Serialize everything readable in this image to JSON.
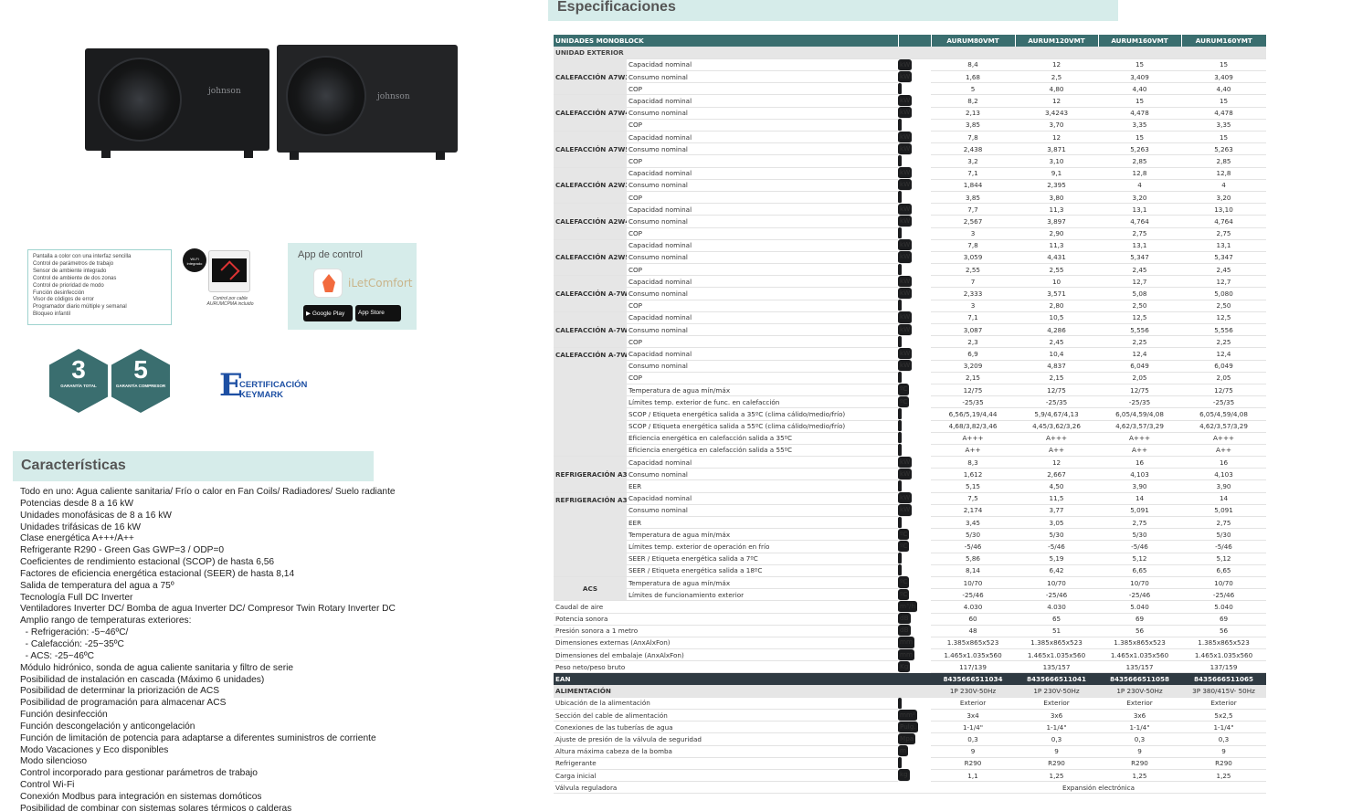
{
  "product": {
    "brand": "johnson"
  },
  "features_box": [
    "Pantalla a color con una interfaz sencilla",
    "Control de parámetros de trabajo",
    "Sensor de ambiente integrado",
    "Control de ambiente de dos zonas",
    "Control de prioridad de modo",
    "Función desinfección",
    "Visor de códigos de error",
    "Programador diario múltiple y semanal",
    "Bloqueo infantil"
  ],
  "wifi": {
    "label": "Wi-Fi integrado",
    "caption": "Control por cable AURUMCPMA incluido"
  },
  "app": {
    "title": "App de control",
    "name": "iLetComfort",
    "google": "Google Play",
    "apple": "App Store"
  },
  "badges": [
    {
      "num": "3",
      "label": "GARANTÍA TOTAL"
    },
    {
      "num": "5",
      "label": "GARANTÍA COMPRESOR"
    }
  ],
  "keymark": {
    "line1": "CERTIFICACIÓN",
    "line2": "KEYMARK"
  },
  "caracteristicas": {
    "title": "Características",
    "items": [
      "Todo en uno: Agua caliente sanitaria/ Frío o calor en Fan Coils/ Radiadores/ Suelo radiante",
      "Potencias desde 8 a 16 kW",
      "Unidades monofásicas de 8 a 16 kW",
      "Unidades trifásicas de 16 kW",
      "Clase energética A+++/A++",
      "Refrigerante R290 - Green Gas GWP=3 / ODP=0",
      "Coeficientes de rendimiento estacional (SCOP) de hasta 6,56",
      "Factores de eficiencia energética estacional (SEER) de hasta 8,14",
      "Salida de temperatura del agua a 75º",
      "Tecnología Full DC Inverter",
      "Ventiladores Inverter DC/ Bomba de agua Inverter DC/ Compresor Twin Rotary Inverter DC",
      "Amplio rango de temperaturas exteriores:",
      "  - Refrigeración: -5~46ºC/",
      "  - Calefacción: -25~35ºC",
      "  - ACS: -25~46ºC",
      "Módulo hidrónico, sonda de agua caliente sanitaria y filtro de serie",
      "Posibilidad de instalación en cascada (Máximo 6 unidades)",
      "Posibilidad de determinar la priorización de ACS",
      "Posibilidad de programación para almacenar ACS",
      "Función desinfección",
      "Función descongelación y anticongelación",
      "Función de limitación de potencia para adaptarse a diferentes suministros de corriente",
      "Modo Vacaciones y Eco disponibles",
      "Modo silencioso",
      "Control incorporado para gestionar parámetros de trabajo",
      "Control Wi-Fi",
      "Conexión Modbus para integración en sistemas domóticos",
      "Posibilidad de combinar con sistemas solares térmicos o calderas"
    ]
  },
  "spec": {
    "title": "Especificaciones",
    "header": [
      "UNIDADES MONOBLOCK",
      "AURUM80VMT",
      "AURUM120VMT",
      "AURUM160VMT",
      "AURUM160YMT"
    ],
    "subheader": "UNIDAD EXTERIOR",
    "groups": [
      {
        "name": "CALEFACCIÓN A7W35",
        "rows": [
          [
            "Capacidad nominal",
            "kW",
            "8,4",
            "12",
            "15",
            "15"
          ],
          [
            "Consumo nominal",
            "kW",
            "1,68",
            "2,5",
            "3,409",
            "3,409"
          ],
          [
            "COP",
            "",
            "5",
            "4,80",
            "4,40",
            "4,40"
          ]
        ]
      },
      {
        "name": "CALEFACCIÓN A7W45",
        "rows": [
          [
            "Capacidad nominal",
            "kW",
            "8,2",
            "12",
            "15",
            "15"
          ],
          [
            "Consumo nominal",
            "kW",
            "2,13",
            "3,4243",
            "4,478",
            "4,478"
          ],
          [
            "COP",
            "",
            "3,85",
            "3,70",
            "3,35",
            "3,35"
          ]
        ]
      },
      {
        "name": "CALEFACCIÓN A7W55",
        "rows": [
          [
            "Capacidad nominal",
            "kW",
            "7,8",
            "12",
            "15",
            "15"
          ],
          [
            "Consumo nominal",
            "kW",
            "2,438",
            "3,871",
            "5,263",
            "5,263"
          ],
          [
            "COP",
            "",
            "3,2",
            "3,10",
            "2,85",
            "2,85"
          ]
        ]
      },
      {
        "name": "CALEFACCIÓN A2W35",
        "rows": [
          [
            "Capacidad nominal",
            "kW",
            "7,1",
            "9,1",
            "12,8",
            "12,8"
          ],
          [
            "Consumo nominal",
            "kW",
            "1,844",
            "2,395",
            "4",
            "4"
          ],
          [
            "COP",
            "",
            "3,85",
            "3,80",
            "3,20",
            "3,20"
          ]
        ]
      },
      {
        "name": "CALEFACCIÓN A2W45",
        "rows": [
          [
            "Capacidad nominal",
            "kW",
            "7,7",
            "11,3",
            "13,1",
            "13,10"
          ],
          [
            "Consumo nominal",
            "kW",
            "2,567",
            "3,897",
            "4,764",
            "4,764"
          ],
          [
            "COP",
            "",
            "3",
            "2,90",
            "2,75",
            "2,75"
          ]
        ]
      },
      {
        "name": "CALEFACCIÓN A2W55",
        "rows": [
          [
            "Capacidad nominal",
            "kW",
            "7,8",
            "11,3",
            "13,1",
            "13,1"
          ],
          [
            "Consumo nominal",
            "kW",
            "3,059",
            "4,431",
            "5,347",
            "5,347"
          ],
          [
            "COP",
            "",
            "2,55",
            "2,55",
            "2,45",
            "2,45"
          ]
        ]
      },
      {
        "name": "CALEFACCIÓN A-7W35",
        "rows": [
          [
            "Capacidad nominal",
            "kW",
            "7",
            "10",
            "12,7",
            "12,7"
          ],
          [
            "Consumo nominal",
            "kW",
            "2,333",
            "3,571",
            "5,08",
            "5,080"
          ],
          [
            "COP",
            "",
            "3",
            "2,80",
            "2,50",
            "2,50"
          ]
        ]
      },
      {
        "name": "CALEFACCIÓN A-7W45",
        "rows": [
          [
            "Capacidad nominal",
            "kW",
            "7,1",
            "10,5",
            "12,5",
            "12,5"
          ],
          [
            "Consumo nominal",
            "kW",
            "3,087",
            "4,286",
            "5,556",
            "5,556"
          ],
          [
            "COP",
            "",
            "2,3",
            "2,45",
            "2,25",
            "2,25"
          ]
        ]
      },
      {
        "name": "CALEFACCIÓN A-7W55",
        "rows": [
          [
            "Capacidad nominal",
            "kW",
            "6,9",
            "10,4",
            "12,4",
            "12,4"
          ],
          [
            "Consumo nominal",
            "kW",
            "3,209",
            "4,837",
            "6,049",
            "6,049"
          ],
          [
            "COP",
            "",
            "2,15",
            "2,15",
            "2,05",
            "2,05"
          ],
          [
            "Temperatura de agua mín/máx",
            "ºC",
            "12/75",
            "12/75",
            "12/75",
            "12/75"
          ],
          [
            "Límites temp. exterior de func. en calefacción",
            "ºC",
            "-25/35",
            "-25/35",
            "-25/35",
            "-25/35"
          ],
          [
            "SCOP / Etiqueta energética salida a 35ºC (clima cálido/medio/frío)",
            "",
            "6,56/5,19/4,44",
            "5,9/4,67/4,13",
            "6,05/4,59/4,08",
            "6,05/4,59/4,08"
          ],
          [
            "SCOP / Etiqueta energética salida a 55ºC (clima cálido/medio/frío)",
            "",
            "4,68/3,82/3,46",
            "4,45/3,62/3,26",
            "4,62/3,57/3,29",
            "4,62/3,57/3,29"
          ],
          [
            "Eficiencia energética en calefacción salida a 35ºC",
            "",
            "A+++",
            "A+++",
            "A+++",
            "A+++"
          ],
          [
            "Eficiencia energética en calefacción salida a 55ºC",
            "",
            "A++",
            "A++",
            "A++",
            "A++"
          ]
        ]
      },
      {
        "name": "REFRIGERACIÓN A35W18",
        "rows": [
          [
            "Capacidad nominal",
            "kW",
            "8,3",
            "12",
            "16",
            "16"
          ],
          [
            "Consumo nominal",
            "kW",
            "1,612",
            "2,667",
            "4,103",
            "4,103"
          ],
          [
            "EER",
            "",
            "5,15",
            "4,50",
            "3,90",
            "3,90"
          ]
        ]
      },
      {
        "name": "REFRIGERACIÓN A35W7",
        "rows": [
          [
            "Capacidad nominal",
            "kW",
            "7,5",
            "11,5",
            "14",
            "14"
          ],
          [
            "Consumo nominal",
            "kW",
            "2,174",
            "3,77",
            "5,091",
            "5,091"
          ],
          [
            "EER",
            "",
            "3,45",
            "3,05",
            "2,75",
            "2,75"
          ],
          [
            "Temperatura de agua mín/máx",
            "ºC",
            "5/30",
            "5/30",
            "5/30",
            "5/30"
          ],
          [
            "Límites temp. exterior de operación en frío",
            "ºC",
            "-5/46",
            "-5/46",
            "-5/46",
            "-5/46"
          ],
          [
            "SEER / Etiqueta energética salida a 7ºC",
            "",
            "5,86",
            "5,19",
            "5,12",
            "5,12"
          ],
          [
            "SEER / Etiqueta energética salida a 18ºC",
            "",
            "8,14",
            "6,42",
            "6,65",
            "6,65"
          ]
        ]
      },
      {
        "name": "ACS",
        "rows": [
          [
            "Temperatura de agua mín/máx",
            "ºC",
            "10/70",
            "10/70",
            "10/70",
            "10/70"
          ],
          [
            "Límites de funcionamiento exterior",
            "ºC",
            "-25/46",
            "-25/46",
            "-25/46",
            "-25/46"
          ]
        ]
      }
    ],
    "general": [
      [
        "Caudal de aire",
        "m³/h",
        "4.030",
        "4.030",
        "5.040",
        "5.040"
      ],
      [
        "Potencia sonora",
        "dB",
        "60",
        "65",
        "69",
        "69"
      ],
      [
        "Presión sonora a 1 metro",
        "dB",
        "48",
        "51",
        "56",
        "56"
      ],
      [
        "Dimensiones externas (AnxAlxFon)",
        "mm",
        "1.385x865x523",
        "1.385x865x523",
        "1.385x865x523",
        "1.385x865x523"
      ],
      [
        "Dimensiones del embalaje (AnxAlxFon)",
        "mm",
        "1.465x1.035x560",
        "1.465x1.035x560",
        "1.465x1.035x560",
        "1.465x1.035x560"
      ],
      [
        "Peso neto/peso bruto",
        "Kg",
        "117/139",
        "135/157",
        "135/157",
        "137/159"
      ]
    ],
    "ean": [
      "EAN",
      "8435666511034",
      "8435666511041",
      "8435666511058",
      "8435666511065"
    ],
    "alimentacion": [
      "ALIMENTACIÓN",
      "1P 230V-50Hz",
      "1P 230V-50Hz",
      "1P 230V-50Hz",
      "3P 380/415V- 50Hz"
    ],
    "extra": [
      [
        "Ubicación de la alimentación",
        "",
        "Exterior",
        "Exterior",
        "Exterior",
        "Exterior"
      ],
      [
        "Sección del cable de alimentación",
        "mm²",
        "3x4",
        "3x6",
        "3x6",
        "5x2,5"
      ],
      [
        "Conexiones de las tuberías de agua",
        "Pulg.",
        "1-1/4\"",
        "1-1/4\"",
        "1-1/4\"",
        "1-1/4\""
      ],
      [
        "Ajuste de presión de la válvula de seguridad",
        "Mpa",
        "0,3",
        "0,3",
        "0,3",
        "0,3"
      ],
      [
        "Altura máxima cabeza de la bomba",
        "m",
        "9",
        "9",
        "9",
        "9"
      ],
      [
        "Refrigerante",
        "",
        "R290",
        "R290",
        "R290",
        "R290"
      ],
      [
        "Carga inicial",
        "kg",
        "1,1",
        "1,25",
        "1,25",
        "1,25"
      ]
    ],
    "valvula": [
      "Válvula reguladora",
      "Expansión electrónica"
    ]
  }
}
